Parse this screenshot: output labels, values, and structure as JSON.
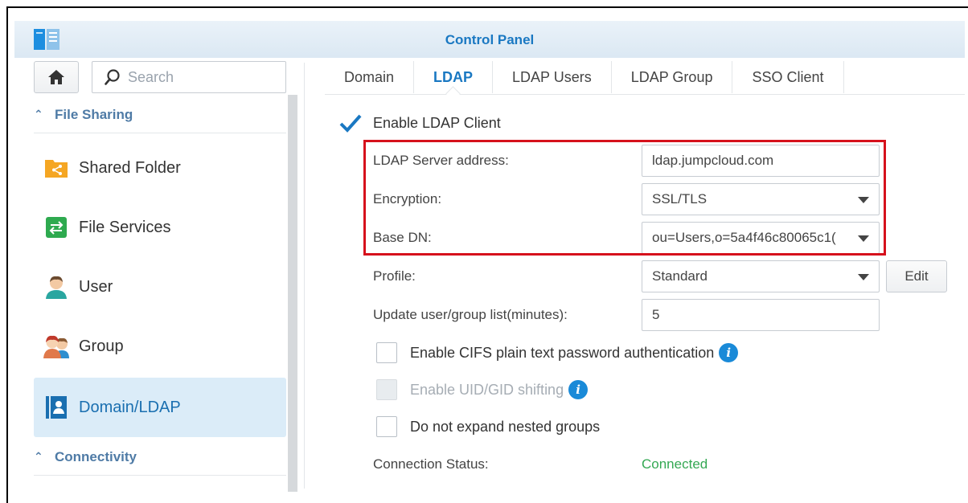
{
  "window": {
    "title": "Control Panel"
  },
  "sidebar": {
    "search": {
      "placeholder": "Search",
      "value": ""
    },
    "sections": [
      {
        "label": "File Sharing"
      },
      {
        "label": "Connectivity"
      }
    ],
    "items": [
      {
        "label": "Shared Folder",
        "icon": "shared-folder-icon",
        "color": "#f5a623"
      },
      {
        "label": "File Services",
        "icon": "file-services-icon",
        "color": "#2eaa4f"
      },
      {
        "label": "User",
        "icon": "user-icon",
        "color": "#2aa6a0"
      },
      {
        "label": "Group",
        "icon": "group-icon",
        "color": "#e0794b"
      },
      {
        "label": "Domain/LDAP",
        "icon": "domain-ldap-icon",
        "color": "#1a6fb0",
        "active": true
      }
    ]
  },
  "tabs": [
    {
      "label": "Domain"
    },
    {
      "label": "LDAP",
      "active": true
    },
    {
      "label": "LDAP Users"
    },
    {
      "label": "LDAP Group"
    },
    {
      "label": "SSO Client"
    }
  ],
  "form": {
    "enable_ldap": {
      "label": "Enable LDAP Client",
      "checked": true
    },
    "server_address": {
      "label": "LDAP Server address:",
      "value": "ldap.jumpcloud.com"
    },
    "encryption": {
      "label": "Encryption:",
      "value": "SSL/TLS"
    },
    "base_dn": {
      "label": "Base DN:",
      "value": "ou=Users,o=5a4f46c80065c1("
    },
    "profile": {
      "label": "Profile:",
      "value": "Standard",
      "edit_label": "Edit"
    },
    "update_interval": {
      "label": "Update user/group list(minutes):",
      "value": "5"
    },
    "cifs": {
      "label": "Enable CIFS plain text password authentication",
      "checked": false
    },
    "uid_gid": {
      "label": "Enable UID/GID shifting",
      "checked": false,
      "disabled": true
    },
    "nested": {
      "label": "Do not expand nested groups",
      "checked": false
    },
    "status": {
      "label": "Connection Status:",
      "value": "Connected",
      "color": "#34a853"
    }
  },
  "colors": {
    "accent": "#1a78c2",
    "highlight": "#d6111c"
  }
}
